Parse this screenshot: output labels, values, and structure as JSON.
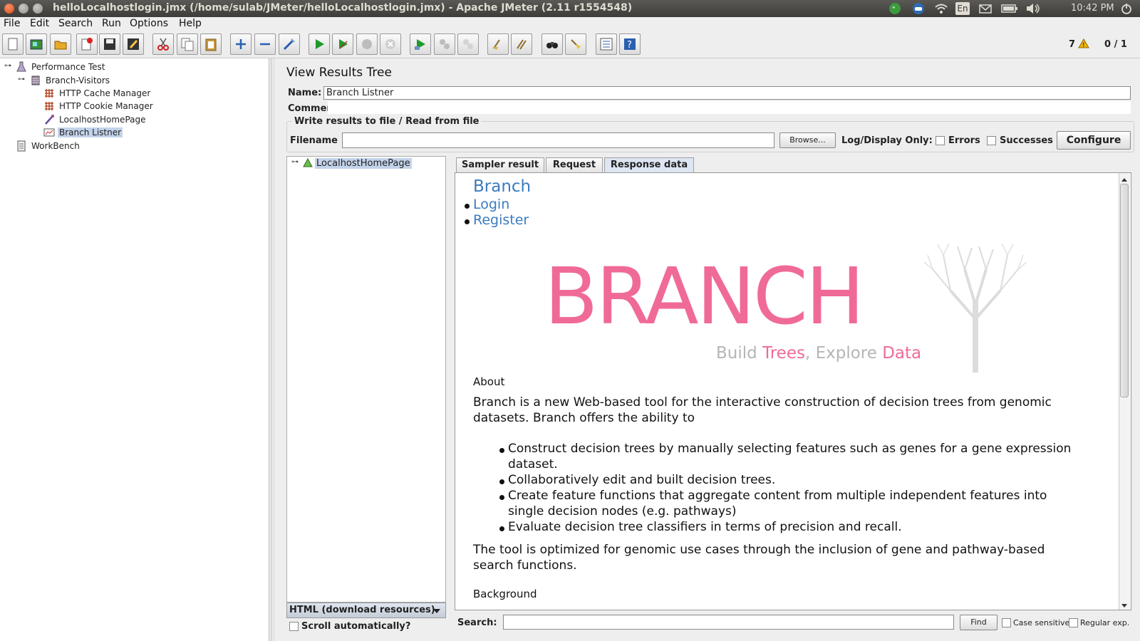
{
  "window": {
    "title": "helloLocalhostlogin.jmx (/home/sulab/JMeter/helloLocalhostlogin.jmx) - Apache JMeter (2.11 r1554548)",
    "clock": "10:42 PM",
    "lang": "En"
  },
  "menu": [
    {
      "label": "File"
    },
    {
      "label": "Edit"
    },
    {
      "label": "Search"
    },
    {
      "label": "Run"
    },
    {
      "label": "Options"
    },
    {
      "label": "Help"
    }
  ],
  "toolbar": {
    "warning_count": "7",
    "threads": "0 / 1"
  },
  "tree": [
    {
      "label": "Performance Test"
    },
    {
      "label": "Branch-Visitors"
    },
    {
      "label": "HTTP Cache Manager"
    },
    {
      "label": "HTTP Cookie Manager"
    },
    {
      "label": "LocalhostHomePage"
    },
    {
      "label": "Branch Listner"
    },
    {
      "label": "WorkBench"
    }
  ],
  "panel": {
    "title": "View Results Tree",
    "name_label": "Name:",
    "name_value": "Branch Listner",
    "comments_label": "Comments:",
    "file_group_title": "Write results to file / Read from file",
    "filename_label": "Filename",
    "browse_label": "Browse...",
    "log_display_label": "Log/Display Only:",
    "errors_label": "Errors",
    "successes_label": "Successes",
    "configure_label": "Configure"
  },
  "results": {
    "sample": "LocalhostHomePage",
    "renderer": "HTML (download resources)",
    "scroll_auto": "Scroll automatically?"
  },
  "tabs": [
    {
      "label": "Sampler result"
    },
    {
      "label": "Request"
    },
    {
      "label": "Response data"
    }
  ],
  "response": {
    "heading": "Branch",
    "links": [
      "Login",
      "Register"
    ],
    "logo_text": "BRANCH",
    "tagline": {
      "a": "Build ",
      "b": "Trees",
      "c": ", Explore ",
      "d": "Data"
    },
    "about_heading": "About",
    "about_p1_line1": "Branch is a new Web-based tool for the interactive construction of decision trees from genomic",
    "about_p1_line2": "datasets. Branch offers the ability to",
    "list": [
      {
        "l1": "Construct decision trees by manually selecting features such as genes for a gene expression",
        "l2": "dataset."
      },
      {
        "l1": "Collaboratively edit and built decision trees.",
        "l2": ""
      },
      {
        "l1": "Create feature functions that aggregate content from multiple independent features into",
        "l2": "single decision nodes (e.g. pathways)"
      },
      {
        "l1": "Evaluate decision tree classifiers in terms of precision and recall.",
        "l2": ""
      }
    ],
    "p2_line1": "The tool is optimized for genomic use cases through the inclusion of gene and pathway-based",
    "p2_line2": "search functions.",
    "background_heading": "Background"
  },
  "search": {
    "label": "Search:",
    "find_label": "Find",
    "case_label": "Case sensitive",
    "regex_label": "Regular exp."
  },
  "colors": {
    "accent_pink": "#f06a98",
    "link_blue": "#3b7bbf",
    "selection": "#c2d3ea"
  }
}
